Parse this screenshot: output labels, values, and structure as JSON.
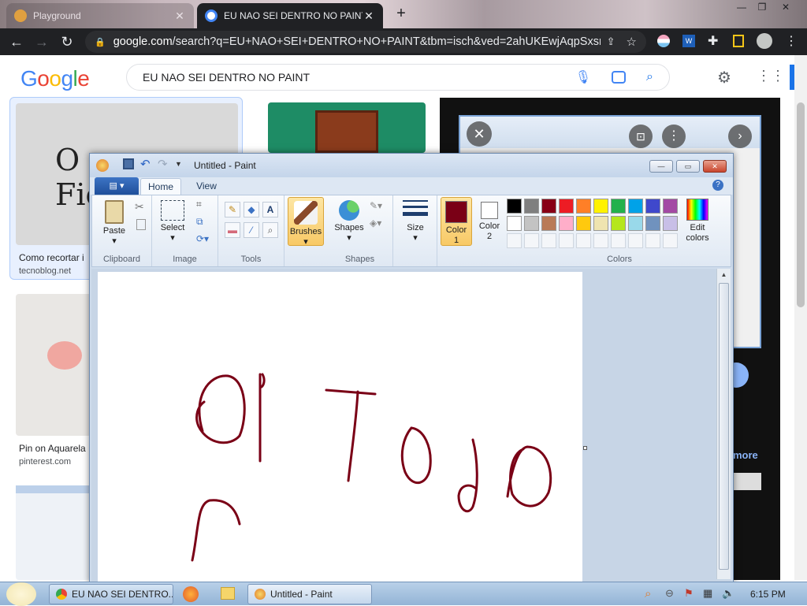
{
  "browser": {
    "tabs": [
      {
        "title": "Playground",
        "active": false
      },
      {
        "title": "EU NAO SEI DENTRO NO PAINT",
        "active": true
      }
    ],
    "new_tab_symbol": "+",
    "url_domain": "google.com",
    "url_rest": "/search?q=EU+NAO+SEI+DENTRO+NO+PAINT&tbm=isch&ved=2ahUKEwjAqpSxsr_..."
  },
  "google": {
    "logo": "Google",
    "query": "EU NAO SEI DENTRO NO PAINT",
    "results": [
      {
        "title": "Como recortar i",
        "source": "tecnoblog.net"
      },
      {
        "title": "Pin on Aquarela",
        "source": "pinterest.com"
      }
    ],
    "preview_more": "more"
  },
  "paint": {
    "window_title": "Untitled - Paint",
    "tabs": {
      "home": "Home",
      "view": "View"
    },
    "groups": {
      "clipboard": "Clipboard",
      "image": "Image",
      "tools": "Tools",
      "shapes": "Shapes",
      "colors": "Colors"
    },
    "buttons": {
      "paste": "Paste",
      "select": "Select",
      "brushes": "Brushes",
      "shapes": "Shapes",
      "size": "Size",
      "color1_line1": "Color",
      "color1_line2": "1",
      "color2_line1": "Color",
      "color2_line2": "2",
      "edit_colors_line1": "Edit",
      "edit_colors_line2": "colors"
    },
    "color1": "#7a0016",
    "color2": "#ffffff",
    "palette_row1": [
      "#000000",
      "#7f7f7f",
      "#880015",
      "#ed1c24",
      "#ff7f27",
      "#fff200",
      "#22b14c",
      "#00a2e8",
      "#3f48cc",
      "#a349a4"
    ],
    "palette_row2": [
      "#ffffff",
      "#c3c3c3",
      "#b97a57",
      "#ffaec9",
      "#ffc90e",
      "#efe4b0",
      "#b5e61d",
      "#99d9ea",
      "#7092be",
      "#c8bfe7"
    ],
    "stroke_color": "#7a0016"
  },
  "taskbar": {
    "items": [
      {
        "label": "EU NAO SEI DENTRO..."
      },
      {
        "label": "Untitled - Paint"
      }
    ],
    "time": "6:15 PM"
  }
}
